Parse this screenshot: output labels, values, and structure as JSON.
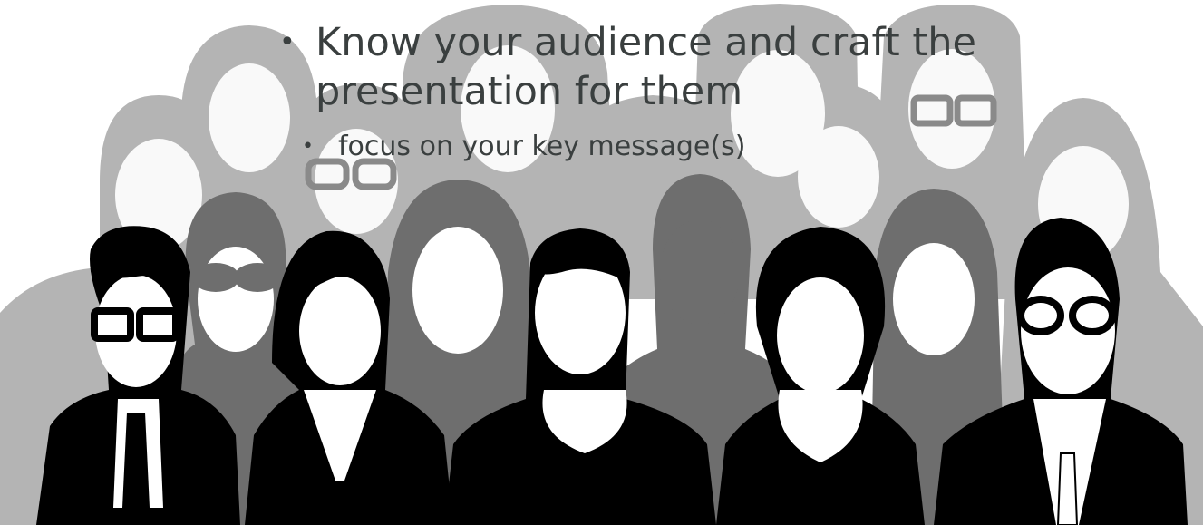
{
  "slide": {
    "bullets": [
      {
        "text": "Know your audience and craft the presentation for them"
      },
      {
        "text": "focus on your key message(s)"
      }
    ],
    "bullet_glyph": "•",
    "illustration": "audience-crowd-silhouettes",
    "colors": {
      "text": "#3a3f3f",
      "back_row": "#b4b4b4",
      "middle_row": "#6e6e6e",
      "front_row": "#000000",
      "faces": "#ffffff"
    }
  }
}
